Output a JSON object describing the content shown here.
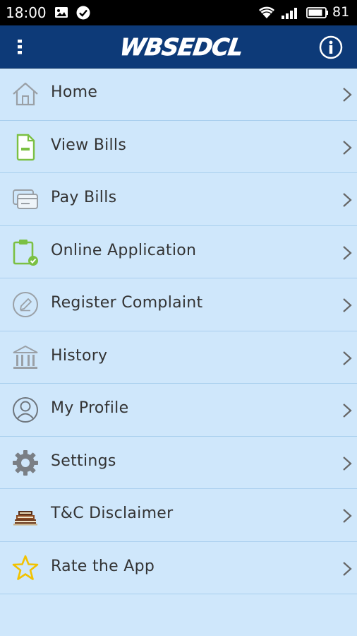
{
  "status_bar": {
    "time": "18:00",
    "battery": "81"
  },
  "app_bar": {
    "logo_text": "WBSEDCL"
  },
  "menu": [
    {
      "label": "Home",
      "icon": "home-icon"
    },
    {
      "label": "View Bills",
      "icon": "bill-document-icon"
    },
    {
      "label": "Pay Bills",
      "icon": "credit-card-icon"
    },
    {
      "label": "Online Application",
      "icon": "clipboard-check-icon"
    },
    {
      "label": "Register Complaint",
      "icon": "edit-circle-icon"
    },
    {
      "label": "History",
      "icon": "bank-building-icon"
    },
    {
      "label": "My Profile",
      "icon": "user-circle-icon"
    },
    {
      "label": "Settings",
      "icon": "gear-icon"
    },
    {
      "label": "T&C Disclaimer",
      "icon": "books-icon"
    },
    {
      "label": "Rate the App",
      "icon": "star-icon"
    }
  ],
  "colors": {
    "app_bar": "#0d3a78",
    "background": "#cfe7fb",
    "divider": "#a9cfee",
    "accent_green": "#7bc043",
    "star_yellow": "#f2c200"
  }
}
